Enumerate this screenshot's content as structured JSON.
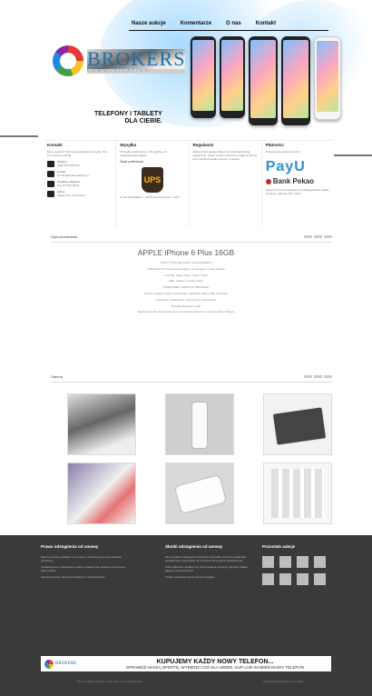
{
  "nav": {
    "items": [
      "Nasze aukcje",
      "Komentarze",
      "O nas",
      "Kontakt"
    ]
  },
  "brand": {
    "name": "BROKERS",
    "sub": "COMMUNICATION"
  },
  "hero": {
    "tagline_1": "TELEFONY I TABLETY",
    "tagline_2": "DLA CIEBIE."
  },
  "columns": {
    "kontakt": {
      "title": "Kontakt",
      "intro": "Masz pytania? Informacje dostępne powyżej, Pon - Pt od 9:00 do 18:00",
      "rows": [
        {
          "label": "Telefon",
          "value": "(048) 570 655 522"
        },
        {
          "label": "E-mail",
          "value": "kontakt@brokersallegro.pl"
        },
        {
          "label": "Godziny otwarcia",
          "value": "Pon-Pt 9:00-18:00"
        },
        {
          "label": "Adres",
          "value": "Męska Gan 5 Rzeszów"
        }
      ]
    },
    "wysylka": {
      "title": "Wysyłka",
      "text": "Przesyłka realizujemy w 24 godziny od zaksięgowania wpłaty.",
      "partner_label": "Nasi partnerzy:",
      "partner": "UPS",
      "note": "Kurier Przedpłata — 16zł   Kurier Pobranie — 20zł"
    },
    "regulamin": {
      "title": "Regulamin",
      "text": "Zakup przez aukcję Allegro oznacza akceptację regulaminu. Towar możesz zwrócić w ciągu 14 dni od otrzymania przesyłki zgodnie z ustawą."
    },
    "platnosci": {
      "title": "Płatności",
      "text": "Przyjmujemy płatności przez:",
      "brand_1": "PayU",
      "brand_2": "Bank Pekao",
      "note": "Zakupiony towar wysyłamy po zaksięgowaniu wpłaty na konto. Faktura VAT marża."
    }
  },
  "sections": {
    "description": "Opis przedmiotu",
    "gallery": "Galeria"
  },
  "product": {
    "title": "APPLE iPhone 6 Plus 16GB",
    "lines": [
      "STAN: TOTALNIE NOWY, ZAFOLIOWANY",
      "GWARANCJA: Producenta (Apple), 12 miesięcy od daty zakupu",
      "KOLOR: Space Gray / Silver / Gold",
      "IMEI: podany w opisie aukcji",
      "POKROWIEC GRATIS W ZESTAWIE",
      "Zestaw zawiera: telefon, ładowarkę, słuchawki, kabel USB, instrukcję",
      "Oryginalne opakowanie, nieużywany, nieotwierany",
      "Wysyłka kurierem w 24h",
      "Zapraszamy do zapoznania się z pozostałymi ofertami w naszym sklepie Allegro"
    ]
  },
  "footer": {
    "col1": {
      "title": "Prawo odstąpienia od umowy",
      "p1": "Klient ma prawo odstąpić od umowy w terminie 14 dni bez podania przyczyny.",
      "p2": "Oświadczenie o odstąpieniu należy wysłać przed upływem terminu na adres sklepu.",
      "p3": "Zwracany towar musi być kompletny i nieuszkodzony."
    },
    "col2": {
      "title": "Skutki odstąpienia od umowy",
      "p1": "W przypadku odstąpienia zwracamy wszystkie otrzymane płatności niezwłocznie, nie później niż 14 dni od otrzymania oświadczenia.",
      "p2": "Zwrot płatności nastąpi przy użyciu takiego samego sposobu zapłaty, jakiego użył konsument.",
      "p3": "Koszty odesłania rzeczy ponosi kupujący."
    },
    "col3": {
      "title": "Pozostałe aukcje"
    },
    "banner_brand": "BROKERS",
    "banner_1": "KUPUJEMY KAŻDY NOWY TELEFON...",
    "banner_2": "SPRAWDŹ NASZĄ OFERTĘ, WYBIERZ COŚ DLA SIEBIE, KUP LUB WYMIEŃ NOWY TELEFON",
    "bottom_left": "Brokers Allegro zakupy - wszystkie prawa zastrzeżone",
    "bottom_right": "Copyright 2015 Designed by FFB"
  }
}
